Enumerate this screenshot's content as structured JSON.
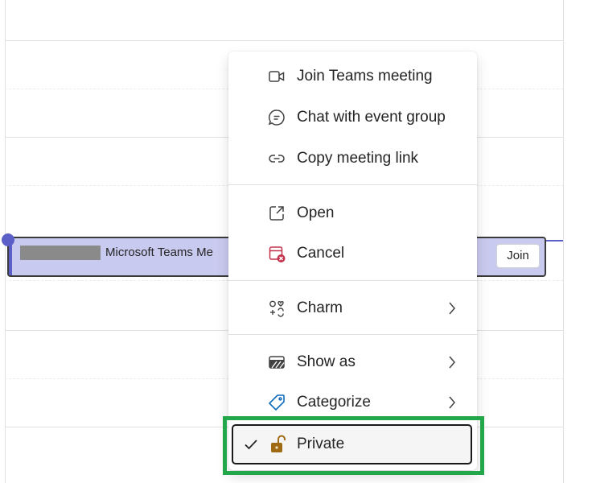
{
  "event": {
    "title": "Microsoft Teams Me",
    "join_label": "Join"
  },
  "menu": {
    "items": [
      {
        "label": "Join Teams meeting",
        "icon": "video-icon"
      },
      {
        "label": "Chat with event group",
        "icon": "chat-icon"
      },
      {
        "label": "Copy meeting link",
        "icon": "link-icon"
      },
      {
        "label": "Open",
        "icon": "open-external-icon"
      },
      {
        "label": "Cancel",
        "icon": "calendar-cancel-icon"
      },
      {
        "label": "Charm",
        "icon": "charm-icon",
        "submenu": true
      },
      {
        "label": "Show as",
        "icon": "show-as-icon",
        "submenu": true
      },
      {
        "label": "Categorize",
        "icon": "tag-icon",
        "submenu": true
      },
      {
        "label": "Private",
        "icon": "lock-open-icon",
        "checked": true
      }
    ]
  },
  "colors": {
    "accent": "#5b5fc7",
    "event_fill": "#c9caef",
    "highlight_border": "#22a74a",
    "cancel_red": "#c4314b",
    "categorize_blue": "#0f6cbd",
    "lock_gold": "#a06a14"
  }
}
